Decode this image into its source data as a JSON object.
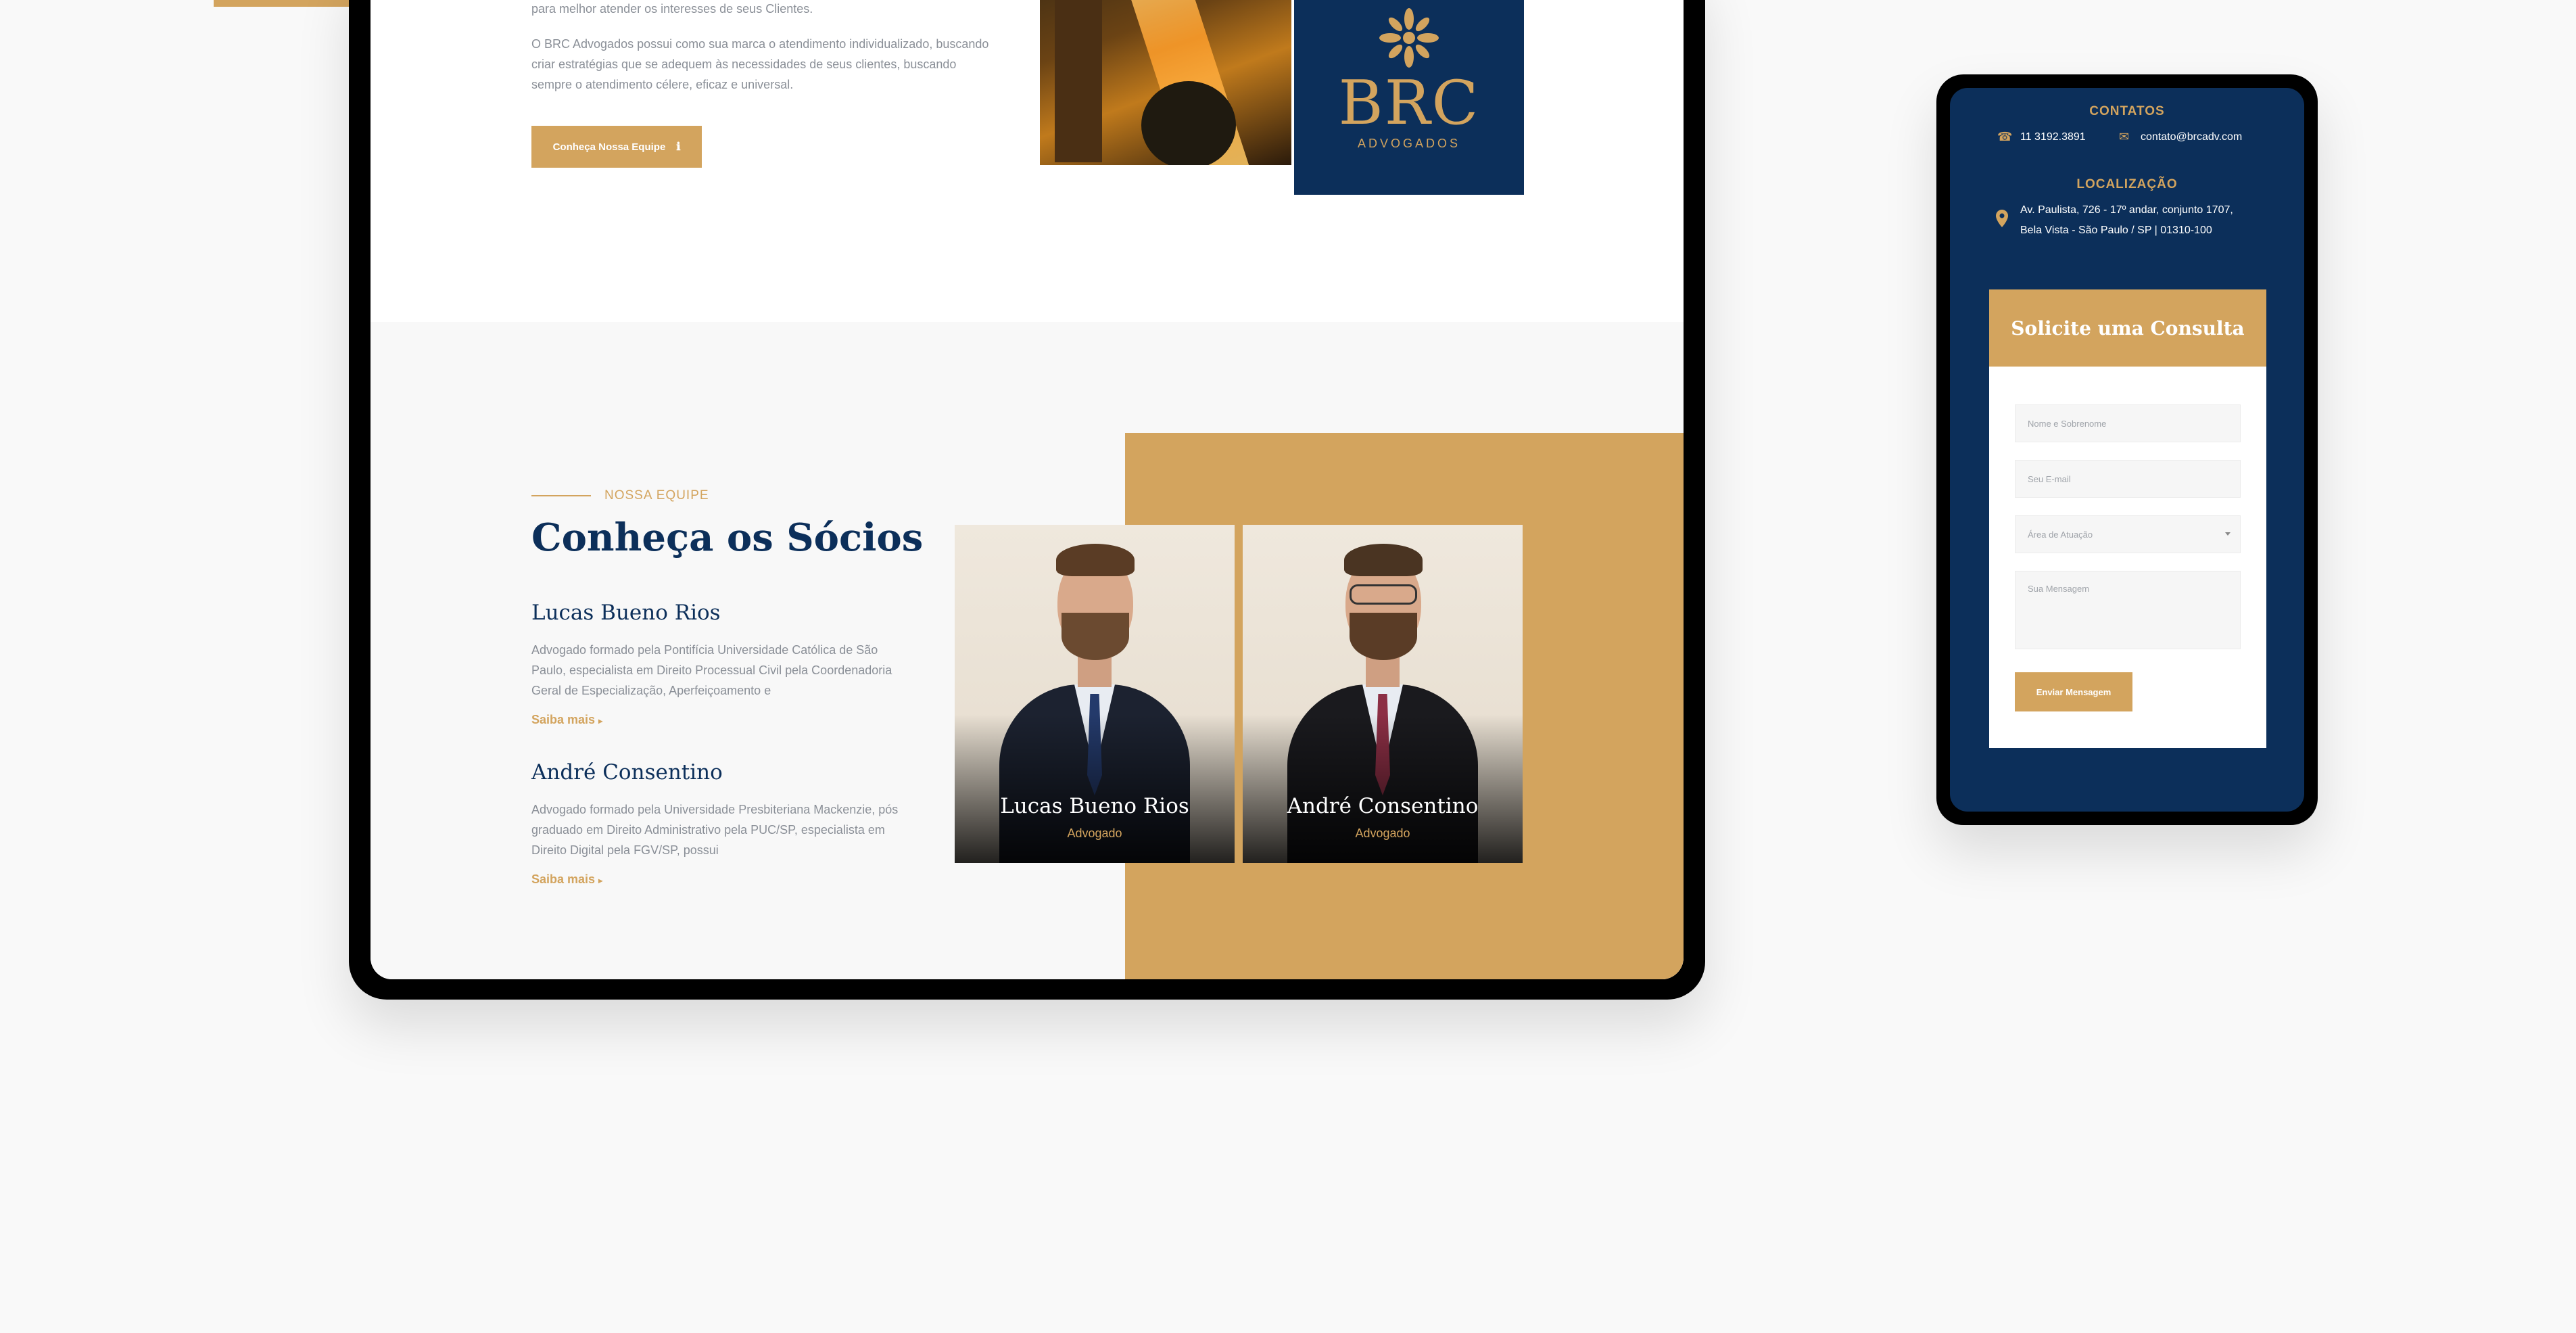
{
  "about": {
    "partial_line": "para melhor atender os interesses de seus Clientes.",
    "paragraph": "O BRC Advogados possui como sua marca o atendimento individualizado, buscando criar estratégias que se adequem às necessidades de seus clientes, buscando sempre o atendimento célere, eficaz e universal.",
    "button_label": "Conheça Nossa Equipe",
    "button_icon": "info-icon"
  },
  "brand": {
    "name": "BRC",
    "subtitle": "ADVOGADOS"
  },
  "team": {
    "eyebrow": "NOSSA EQUIPE",
    "title": "Conheça os Sócios",
    "members": [
      {
        "name": "Lucas Bueno Rios",
        "description": "Advogado formado pela Pontifícia Universidade Católica de São Paulo, especialista em Direito Processual Civil pela Coordenadoria Geral de Especialização, Aperfeiçoamento e",
        "link": "Saiba mais",
        "role": "Advogado"
      },
      {
        "name": "André Consentino",
        "description": "Advogado formado pela Universidade Presbiteriana Mackenzie, pós graduado em Direito Administrativo pela PUC/SP, especialista em Direito Digital pela FGV/SP, possui",
        "link": "Saiba mais",
        "role": "Advogado"
      }
    ]
  },
  "mobile": {
    "contacts_heading": "CONTATOS",
    "phone": "11 3192.3891",
    "email": "contato@brcadv.com",
    "location_heading": "LOCALIZAÇÃO",
    "address_line1": "Av. Paulista, 726 - 17º andar, conjunto 1707,",
    "address_line2": "Bela Vista - São Paulo / SP | 01310-100",
    "form": {
      "title": "Solicite uma Consulta",
      "name_placeholder": "Nome e Sobrenome",
      "email_placeholder": "Seu E-mail",
      "area_placeholder": "Área de Atuação",
      "message_placeholder": "Sua Mensagem",
      "submit_label": "Enviar Mensagem"
    }
  },
  "colors": {
    "navy": "#0c2f5a",
    "gold": "#d3a45e",
    "gray_text": "#8a8f97"
  }
}
